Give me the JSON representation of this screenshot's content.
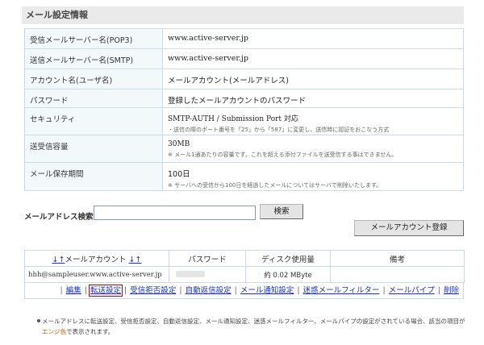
{
  "title": "メール設定情報",
  "info_rows": [
    {
      "label": "受信メールサーバー名(POP3)",
      "value": "www.active-server.jp",
      "note": ""
    },
    {
      "label": "送信メールサーバー名(SMTP)",
      "value": "www.active-server.jp",
      "note": ""
    },
    {
      "label": "アカウント名(ユーザ名)",
      "value": "メールアカウント(メールアドレス)",
      "note": ""
    },
    {
      "label": "パスワード",
      "value": "登録したメールアカウントのパスワード",
      "note": ""
    },
    {
      "label": "セキュリティ",
      "value": "SMTP-AUTH / Submission Port 対応",
      "note": "・送信の際のポート番号を「25」から「587」に変更し、送信時に認証をおこなう方式"
    },
    {
      "label": "送受信容量",
      "value": "30MB",
      "note": "※ メール1通あたりの容量です。これを超える添付ファイルを送受信する事はできません。"
    },
    {
      "label": "メール保存期間",
      "value": "100日",
      "note": "※ サーバへの受信から100日を経過したメールについてはサーバで削除いたします。"
    }
  ],
  "search": {
    "label": "メールアドレス検索:",
    "value": "",
    "button": "検索"
  },
  "register_button": "メールアカウント登録",
  "account_table": {
    "sort_asc": "↓",
    "sort_desc": "↑",
    "headers": {
      "account": "メールアカウント",
      "password": "パスワード",
      "disk": "ディスク使用量",
      "notes": "備考"
    },
    "rows": [
      {
        "email": "hhh@sampleuser.www.active-server.jp",
        "disk": "約 0.02 MByte",
        "notes": ""
      }
    ]
  },
  "action_links": [
    "編集",
    "転送設定",
    "受信拒否設定",
    "自動返信設定",
    "メール通知設定",
    "迷惑メールフィルター",
    "メールパイプ",
    "削除"
  ],
  "action_sep": "|",
  "footnote": {
    "before": "メールアドレスに転送設定、受信拒否設定、自動返信設定、メール通知設定、迷惑メールフィルター、メールパイプの設定がされている場合、該当の項目が",
    "highlight": "エンジ色",
    "after": "で表示されます。"
  },
  "colors": {
    "header_bg": "#eaeaea",
    "border": "#c9dbe4",
    "label_bg": "#f3f8fb",
    "link": "#1a33cc",
    "active_outline": "#cc0000",
    "highlight": "#dd5500"
  }
}
